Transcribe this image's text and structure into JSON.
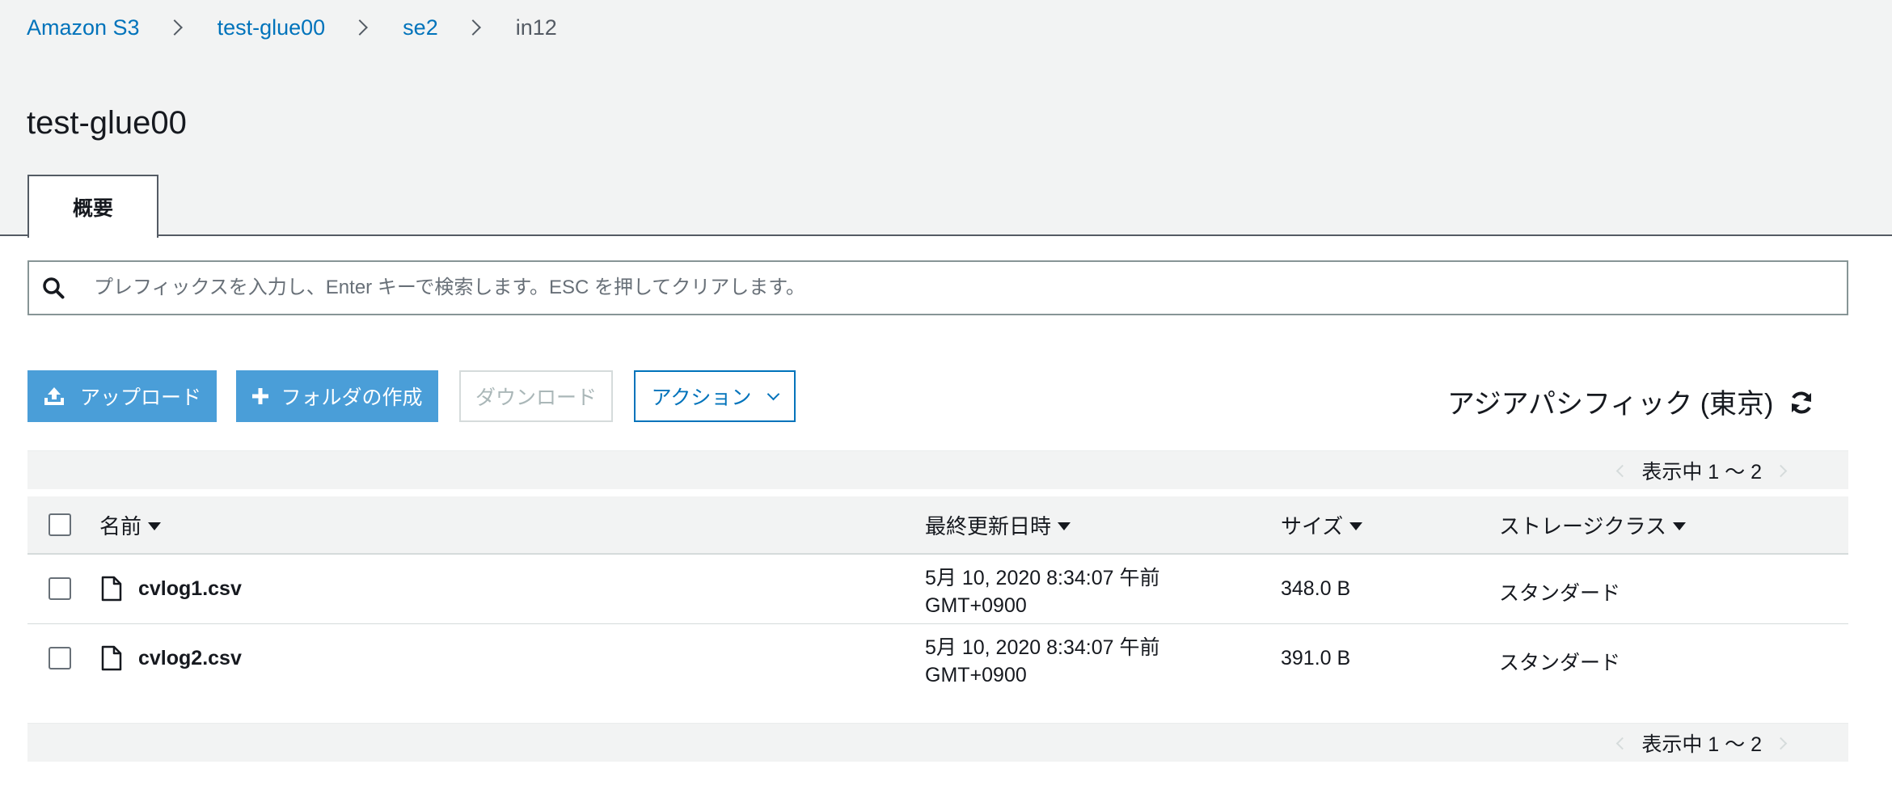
{
  "breadcrumb": {
    "items": [
      "Amazon S3",
      "test-glue00",
      "se2"
    ],
    "current": "in12"
  },
  "page": {
    "title": "test-glue00"
  },
  "tabs": [
    {
      "label": "概要",
      "active": true
    }
  ],
  "search": {
    "placeholder": "プレフィックスを入力し、Enter キーで検索します。ESC を押してクリアします。",
    "value": ""
  },
  "toolbar": {
    "upload_label": "アップロード",
    "create_folder_label": "フォルダの作成",
    "download_label": "ダウンロード",
    "actions_label": "アクション",
    "region_label": "アジアパシフィック (東京)"
  },
  "pagination": {
    "label": "表示中 1 〜 2"
  },
  "table": {
    "columns": [
      "名前",
      "最終更新日時",
      "サイズ",
      "ストレージクラス"
    ],
    "rows": [
      {
        "name": "cvlog1.csv",
        "modified_line1": "5月 10, 2020 8:34:07 午前",
        "modified_line2": "GMT+0900",
        "size": "348.0 B",
        "storage_class": "スタンダード"
      },
      {
        "name": "cvlog2.csv",
        "modified_line1": "5月 10, 2020 8:34:07 午前",
        "modified_line2": "GMT+0900",
        "size": "391.0 B",
        "storage_class": "スタンダード"
      }
    ]
  },
  "colors": {
    "link": "#0073bb",
    "primary_button": "#4a9ed8",
    "header_bg": "#f2f3f3",
    "disabled_text": "#aab7b8"
  },
  "icons": {
    "search": "search-icon",
    "upload": "upload-icon",
    "create_folder": "plus-icon",
    "actions_dropdown": "chevron-down-icon",
    "refresh": "refresh-icon",
    "file": "file-icon",
    "sort": "caret-down-icon"
  }
}
